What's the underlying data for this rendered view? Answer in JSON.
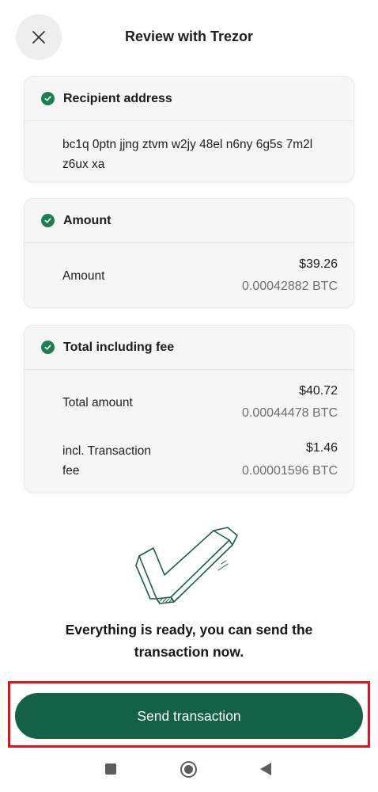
{
  "header": {
    "title": "Review with Trezor",
    "close_icon": "close-icon"
  },
  "recipient": {
    "title": "Recipient address",
    "address_line1": "bc1q 0ptn jjng ztvm w2jy 48el n6ny 6g5s 7m2l",
    "address_line2": "z6ux xa"
  },
  "amount": {
    "title": "Amount",
    "label": "Amount",
    "fiat": "$39.26",
    "crypto": "0.00042882 BTC"
  },
  "total": {
    "title": "Total including fee",
    "total_label": "Total amount",
    "total_fiat": "$40.72",
    "total_crypto": "0.00044478 BTC",
    "fee_label_line1": "incl. Transaction",
    "fee_label_line2": "fee",
    "fee_fiat": "$1.46",
    "fee_crypto": "0.00001596 BTC"
  },
  "ready": {
    "line1": "Everything is ready, you can send the",
    "line2": "transaction now."
  },
  "actions": {
    "send_label": "Send transaction"
  },
  "colors": {
    "accent": "#136146",
    "check": "#1b7f55",
    "highlight": "#e0141a"
  },
  "icons": {
    "check": "check-circle-icon",
    "illustration": "checkmark-illustration",
    "nav_recents": "square-icon",
    "nav_home": "circle-icon",
    "nav_back": "triangle-back-icon"
  }
}
